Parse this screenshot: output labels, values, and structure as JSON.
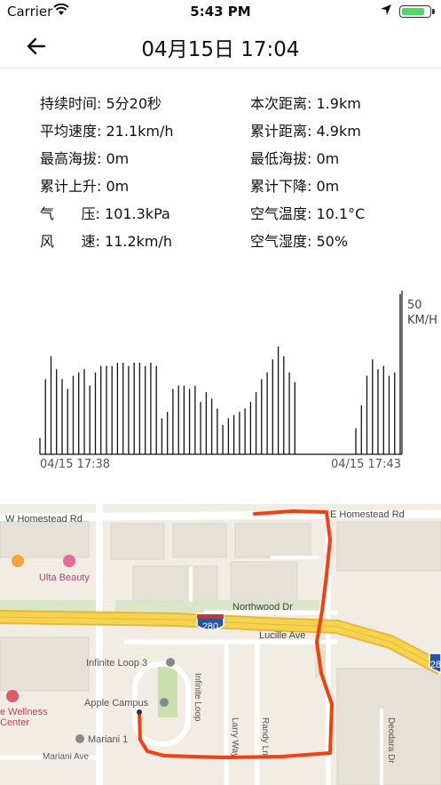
{
  "status": {
    "carrier": "Carrier",
    "time": "5:43 PM",
    "battery_level": 0.9
  },
  "nav": {
    "title": "04月15日 17:04"
  },
  "stats": {
    "left": [
      {
        "label": "持续时间:",
        "value": "5分20秒"
      },
      {
        "label": "平均速度:",
        "value": "21.1km/h"
      },
      {
        "label": "最高海拔:",
        "value": "0m"
      },
      {
        "label": "累计上升:",
        "value": "0m"
      },
      {
        "label": "气      压:",
        "value": "101.3kPa"
      },
      {
        "label": "风      速:",
        "value": "11.2km/h"
      }
    ],
    "right": [
      {
        "label": "本次距离:",
        "value": "1.9km"
      },
      {
        "label": "累计距离:",
        "value": "4.9km"
      },
      {
        "label": "最低海拔:",
        "value": "0m"
      },
      {
        "label": "累计下降:",
        "value": "0m"
      },
      {
        "label": "空气温度:",
        "value": "10.1°C"
      },
      {
        "label": "空气湿度:",
        "value": "50%"
      }
    ]
  },
  "chart_data": {
    "type": "bar",
    "y_max_label": "50",
    "y_unit": "KM/H",
    "x_start_label": "04/15 17:38",
    "x_end_label": "04/15 17:43",
    "ylim": [
      0,
      50
    ],
    "values": [
      5,
      23,
      30,
      26,
      23,
      20,
      24,
      25,
      26,
      21,
      25,
      27,
      27,
      27,
      28,
      28,
      27,
      28,
      28,
      27,
      28,
      27,
      11,
      13,
      20,
      21,
      21,
      20,
      21,
      16,
      19,
      17,
      14,
      9,
      11,
      12,
      13,
      14,
      16,
      19,
      23,
      25,
      29,
      33,
      30,
      25,
      22,
      0,
      0,
      0,
      0,
      0,
      0,
      0,
      0,
      0,
      0,
      8,
      15,
      24,
      29,
      26,
      27,
      24,
      25,
      49
    ]
  },
  "map": {
    "roads": [
      "W Homestead Rd",
      "E Homestead Rd",
      "Northwood Dr",
      "Lucille Ave",
      "Larry Way",
      "Randy Ln",
      "Infinite Loop",
      "Mariani Ave",
      "Deodara Dr"
    ],
    "places": [
      "Ulta Beauty",
      "Infinite Loop 3",
      "Apple Campus",
      "Mariani 1",
      "e Wellness",
      "Center"
    ],
    "highway_shields": [
      "280",
      "28"
    ],
    "colors": {
      "route": "#fb3d0b",
      "highway": "#f5d34d",
      "background": "#f1ede4"
    }
  }
}
